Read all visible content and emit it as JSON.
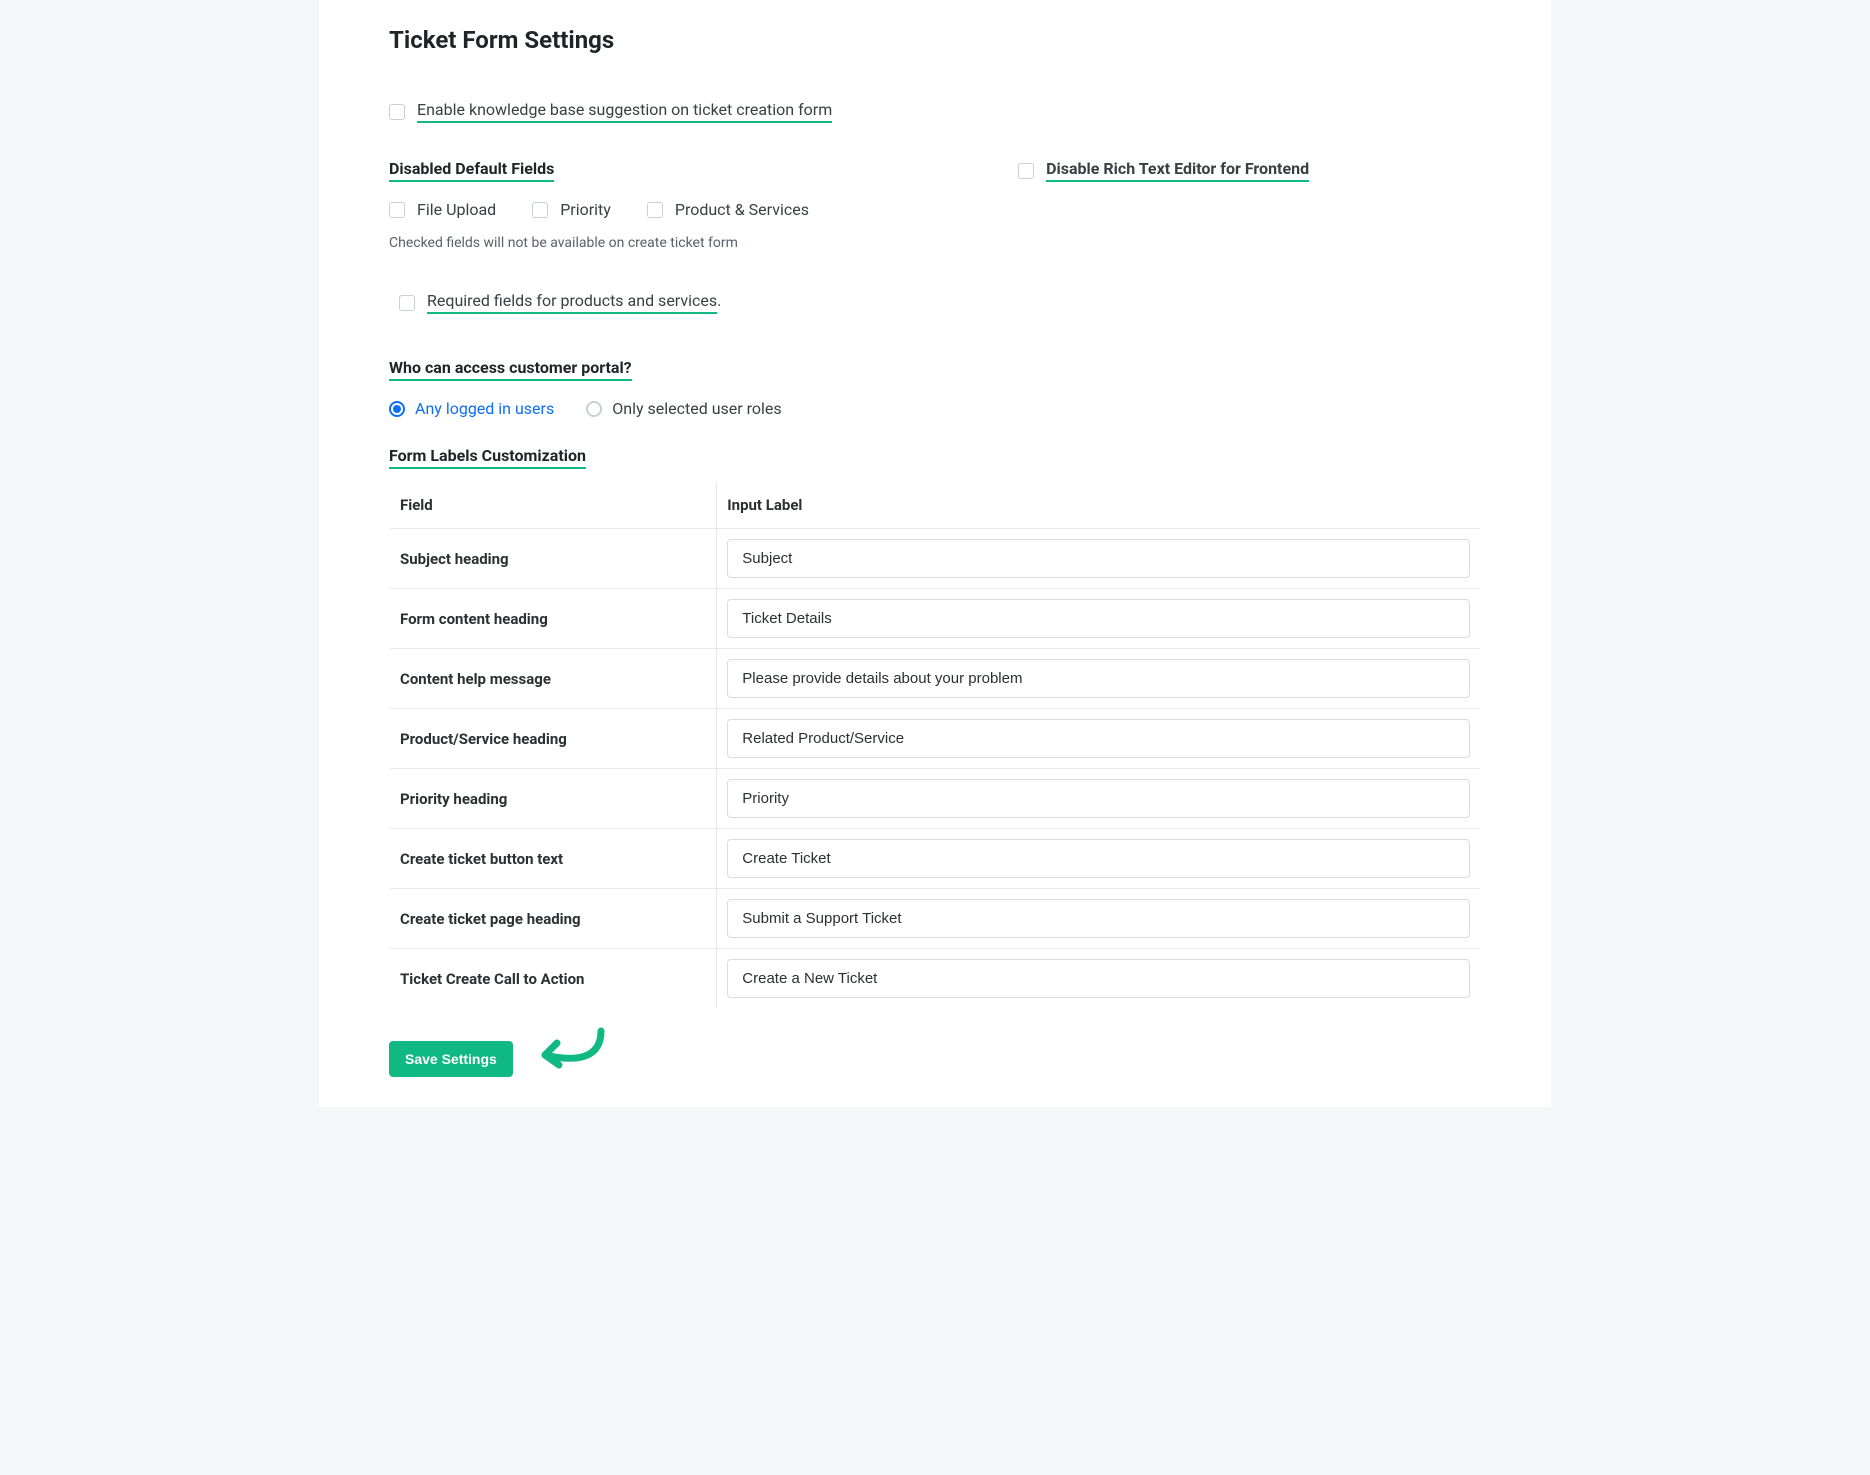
{
  "page_title": "Ticket Form Settings",
  "kb_suggestion_label": "Enable knowledge base suggestion on ticket creation form",
  "disabled_fields_heading": "Disabled Default Fields",
  "disabled_fields": [
    {
      "label": "File Upload"
    },
    {
      "label": "Priority"
    },
    {
      "label": "Product & Services"
    }
  ],
  "disabled_fields_help": "Checked fields will not be available on create ticket form",
  "disable_rte_label": "Disable Rich Text Editor for Frontend",
  "required_products_label": "Required fields for products and services",
  "required_products_suffix": ".",
  "who_access_heading": "Who can access customer portal?",
  "access_options": [
    {
      "label": "Any logged in users",
      "checked": true
    },
    {
      "label": "Only selected user roles",
      "checked": false
    }
  ],
  "form_labels_heading": "Form Labels Customization",
  "table_headers": {
    "field": "Field",
    "input_label": "Input Label"
  },
  "form_label_rows": [
    {
      "field": "Subject heading",
      "value": "Subject"
    },
    {
      "field": "Form content heading",
      "value": "Ticket Details"
    },
    {
      "field": "Content help message",
      "value": "Please provide details about your problem"
    },
    {
      "field": "Product/Service heading",
      "value": "Related Product/Service"
    },
    {
      "field": "Priority heading",
      "value": "Priority"
    },
    {
      "field": "Create ticket button text",
      "value": "Create Ticket"
    },
    {
      "field": "Create ticket page heading",
      "value": "Submit a Support Ticket"
    },
    {
      "field": "Ticket Create Call to Action",
      "value": "Create a New Ticket"
    }
  ],
  "save_button_label": "Save Settings"
}
